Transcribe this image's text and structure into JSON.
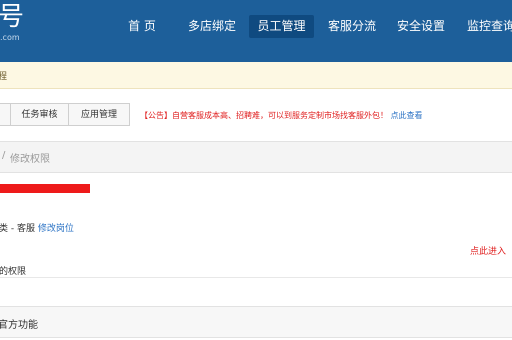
{
  "header": {
    "logo_main": "号",
    "logo_sub": ".com",
    "nav": [
      "首 页",
      "多店绑定",
      "员工管理",
      "客服分流",
      "安全设置",
      "监控查询"
    ],
    "active_nav": "员工管理"
  },
  "notice": {
    "text": "程"
  },
  "tabs": [
    "任务审核",
    "应用管理"
  ],
  "announcement": {
    "text": "【公告】自营客服成本高、招聘难，可以到服务定制市场找客服外包！",
    "link": "点此查看"
  },
  "breadcrumb": {
    "separator": "/",
    "current": "修改权限"
  },
  "content": {
    "role_text": "类 - 客服",
    "role_link": "修改岗位",
    "enter_link": "点此进入",
    "permission_label": "的权限",
    "function_section": "官方功能"
  },
  "colors": {
    "header_bg": "#1d5f9a",
    "active_nav_bg": "#0f4a80",
    "alert_red": "#e02020",
    "link_blue": "#2a72c4",
    "redaction": "#ee1a1a"
  }
}
